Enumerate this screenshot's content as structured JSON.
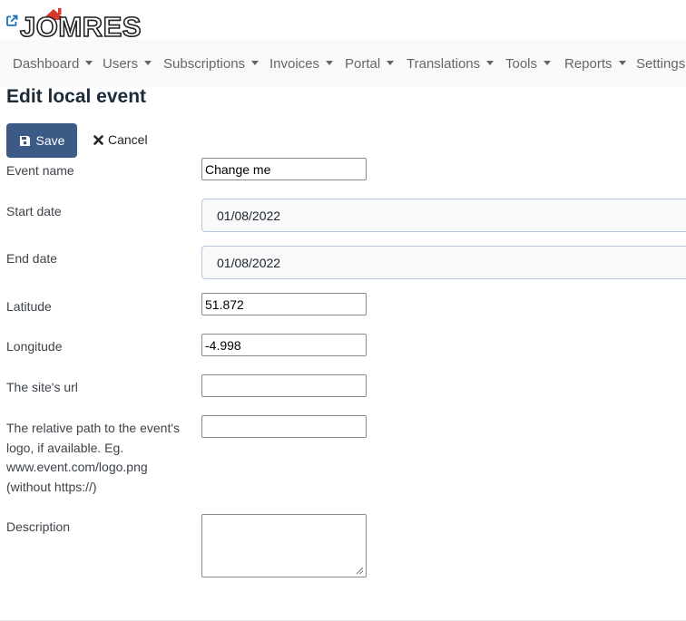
{
  "brand": {
    "logo_text": "JOMRES",
    "accent_color": "#d9382b"
  },
  "nav": {
    "items": [
      "Dashboard",
      "Users",
      "Subscriptions",
      "Invoices",
      "Portal",
      "Translations",
      "Tools",
      "Reports",
      "Settings"
    ]
  },
  "page": {
    "title": "Edit local event"
  },
  "toolbar": {
    "save_label": "Save",
    "cancel_label": "Cancel"
  },
  "form": {
    "event_name": {
      "label": "Event name",
      "value": "Change me"
    },
    "start_date": {
      "label": "Start date",
      "value": "01/08/2022"
    },
    "end_date": {
      "label": "End date",
      "value": "01/08/2022"
    },
    "latitude": {
      "label": "Latitude",
      "value": "51.872"
    },
    "longitude": {
      "label": "Longitude",
      "value": "-4.998"
    },
    "site_url": {
      "label": "The site's url",
      "value": ""
    },
    "logo_path": {
      "label": "The relative path to the event's logo, if available. Eg. www.event.com/logo.png (without https://)",
      "value": ""
    },
    "description": {
      "label": "Description",
      "value": ""
    }
  },
  "icons": {
    "external": "external-link-icon",
    "save": "floppy-disk-icon",
    "cancel": "times-icon"
  },
  "colors": {
    "primary_button": "#3b5a85",
    "link": "#1a6fbf"
  }
}
